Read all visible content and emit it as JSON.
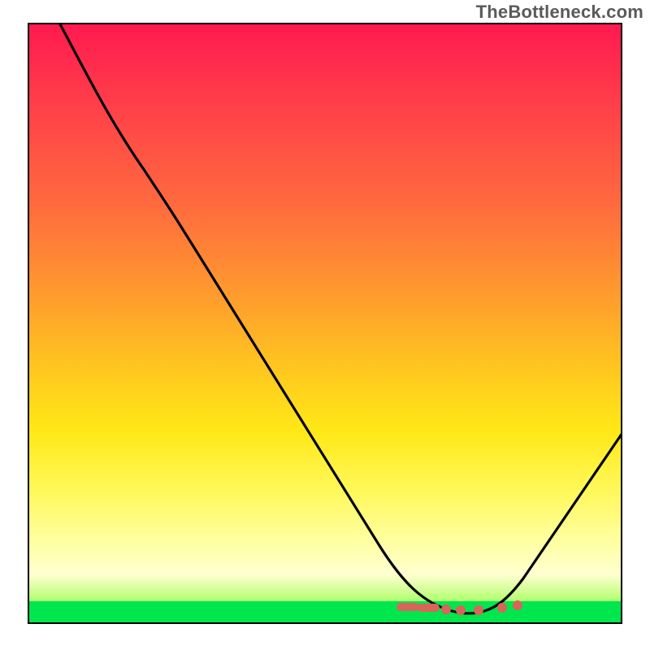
{
  "watermark": "TheBottleneck.com",
  "chart_data": {
    "type": "line",
    "title": "",
    "xlabel": "",
    "ylabel": "",
    "xlim": [
      0,
      100
    ],
    "ylim": [
      0,
      100
    ],
    "grid": false,
    "legend": false,
    "background": "heatmap-gradient (red→orange→yellow→light-green→green, vertical)",
    "series": [
      {
        "name": "bottleneck-curve",
        "color": "#000000",
        "x": [
          5,
          10,
          15,
          20,
          25,
          30,
          35,
          40,
          45,
          50,
          55,
          60,
          65,
          70,
          75,
          77,
          80,
          85,
          90,
          95,
          100
        ],
        "values": [
          100,
          94,
          88,
          81,
          74,
          63,
          55,
          47,
          39,
          31,
          23,
          16,
          10,
          5,
          1,
          0,
          1,
          6,
          14,
          23,
          33
        ]
      }
    ],
    "scatter": [
      {
        "name": "optimal-points",
        "color": "#d9645a",
        "x": [
          65,
          67,
          70,
          72,
          75,
          78,
          81,
          83
        ],
        "values": [
          1.2,
          1.0,
          0.8,
          0.7,
          0.6,
          0.7,
          0.9,
          1.2
        ]
      }
    ]
  },
  "colors": {
    "gradient_top": "#ff1a50",
    "gradient_mid": "#ffe817",
    "gradient_bottom": "#00e64d",
    "curve": "#000000",
    "dots": "#d9645a",
    "frame": "#000000"
  }
}
